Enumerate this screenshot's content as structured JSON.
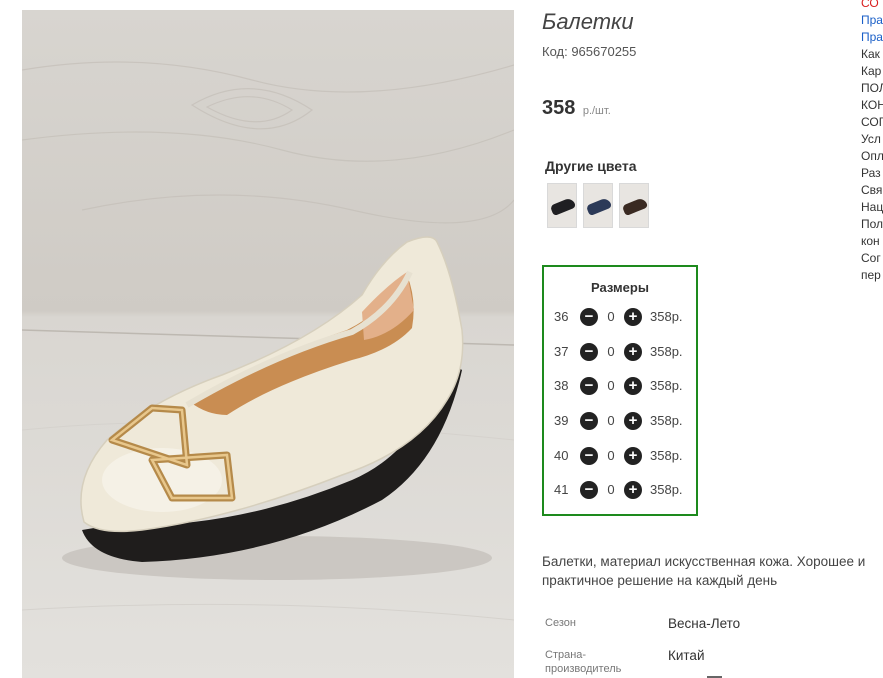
{
  "product": {
    "title": "Балетки",
    "code": "Код: 965670255",
    "price": "358",
    "price_unit": "р./шт."
  },
  "image": {
    "alt": "Балетки"
  },
  "colors": {
    "title": "Другие цвета",
    "swatches": [
      {
        "icon": "black-shoe-icon",
        "color": "#1f1f22"
      },
      {
        "icon": "navy-shoe-icon",
        "color": "#2c3a58"
      },
      {
        "icon": "brown-shoe-icon",
        "color": "#3a2a22"
      }
    ]
  },
  "sizes": {
    "title": "Размеры",
    "rows": [
      {
        "size": "36",
        "qty": "0",
        "price": "358р."
      },
      {
        "size": "37",
        "qty": "0",
        "price": "358р."
      },
      {
        "size": "38",
        "qty": "0",
        "price": "358р."
      },
      {
        "size": "39",
        "qty": "0",
        "price": "358р."
      },
      {
        "size": "40",
        "qty": "0",
        "price": "358р."
      },
      {
        "size": "41",
        "qty": "0",
        "price": "358р."
      }
    ],
    "minus_symbol": "−",
    "plus_symbol": "+"
  },
  "description": "Балетки, материал искусственная кожа. Хорошее и практичное решение на каждый день",
  "attributes": [
    {
      "key": "Сезон",
      "value": "Весна-Лето"
    },
    {
      "key": "Страна-производитель",
      "value": "Китай"
    }
  ],
  "sidebar_links": [
    {
      "text": "СО",
      "style": "red"
    },
    {
      "text": "Пра",
      "style": "blue"
    },
    {
      "text": "Пра",
      "style": "blue"
    },
    {
      "text": "Как",
      "style": "plain"
    },
    {
      "text": "Кар",
      "style": "plain"
    },
    {
      "text": "ПОЛ",
      "style": "plain"
    },
    {
      "text": "КОН",
      "style": "plain"
    },
    {
      "text": "СОГ",
      "style": "plain"
    },
    {
      "text": "Усл",
      "style": "plain"
    },
    {
      "text": "Опл",
      "style": "plain"
    },
    {
      "text": "Раз",
      "style": "plain"
    },
    {
      "text": "Свя",
      "style": "plain"
    },
    {
      "text": "Нац",
      "style": "plain"
    },
    {
      "text": "Пол",
      "style": "plain"
    },
    {
      "text": "кон",
      "style": "plain"
    },
    {
      "text": "Сог",
      "style": "plain"
    },
    {
      "text": "пер",
      "style": "plain"
    }
  ],
  "theme": {
    "accent_border": "#1d8a1d",
    "price_color": "#333333",
    "link_red": "#d81e1e",
    "link_blue": "#1a5fc8"
  }
}
